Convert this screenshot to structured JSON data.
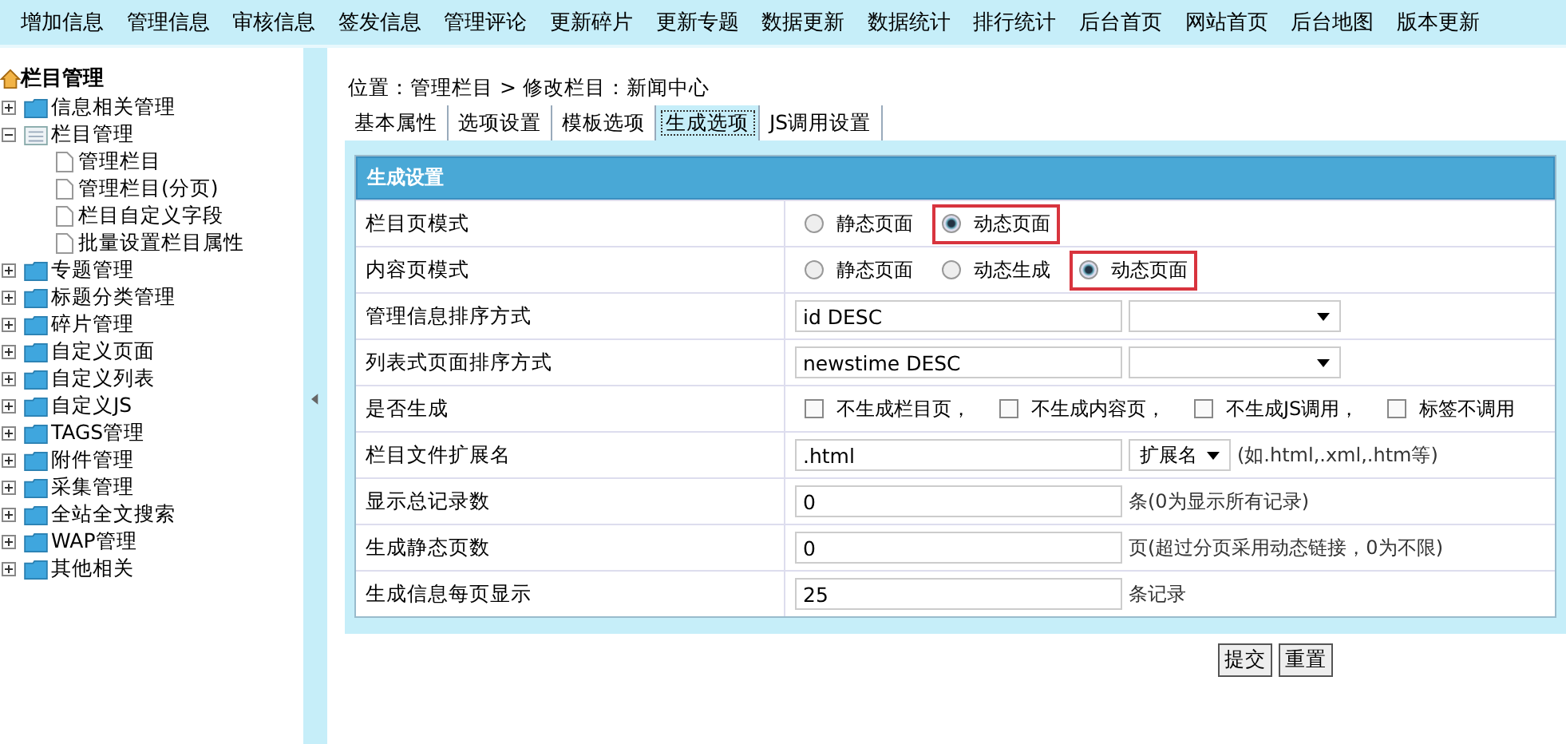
{
  "top_nav": [
    "增加信息",
    "管理信息",
    "审核信息",
    "签发信息",
    "管理评论",
    "更新碎片",
    "更新专题",
    "数据更新",
    "数据统计",
    "排行统计",
    "后台首页",
    "网站首页",
    "后台地图",
    "版本更新"
  ],
  "sidebar": {
    "title": "栏目管理",
    "items": [
      {
        "label": "信息相关管理",
        "expanded": false
      },
      {
        "label": "栏目管理",
        "expanded": true,
        "children": [
          {
            "label": "管理栏目"
          },
          {
            "label": "管理栏目(分页)"
          },
          {
            "label": "栏目自定义字段"
          },
          {
            "label": "批量设置栏目属性"
          }
        ]
      },
      {
        "label": "专题管理",
        "expanded": false
      },
      {
        "label": "标题分类管理",
        "expanded": false
      },
      {
        "label": "碎片管理",
        "expanded": false
      },
      {
        "label": "自定义页面",
        "expanded": false
      },
      {
        "label": "自定义列表",
        "expanded": false
      },
      {
        "label": "自定义JS",
        "expanded": false
      },
      {
        "label": "TAGS管理",
        "expanded": false
      },
      {
        "label": "附件管理",
        "expanded": false
      },
      {
        "label": "采集管理",
        "expanded": false
      },
      {
        "label": "全站全文搜索",
        "expanded": false
      },
      {
        "label": "WAP管理",
        "expanded": false
      },
      {
        "label": "其他相关",
        "expanded": false
      }
    ]
  },
  "breadcrumb": "位置：管理栏目 > 修改栏目：新闻中心",
  "tabs": [
    {
      "label": "基本属性",
      "selected": false
    },
    {
      "label": "选项设置",
      "selected": false
    },
    {
      "label": "模板选项",
      "selected": false
    },
    {
      "label": "生成选项",
      "selected": true
    },
    {
      "label": "JS调用设置",
      "selected": false
    }
  ],
  "form": {
    "title": "生成设置",
    "rows": [
      {
        "kind": "radio",
        "label": "栏目页模式",
        "options": [
          {
            "label": "静态页面",
            "selected": false,
            "highlighted": false
          },
          {
            "label": "动态页面",
            "selected": true,
            "highlighted": true
          }
        ]
      },
      {
        "kind": "radio",
        "label": "内容页模式",
        "options": [
          {
            "label": "静态页面",
            "selected": false,
            "highlighted": false
          },
          {
            "label": "动态生成",
            "selected": false,
            "highlighted": false
          },
          {
            "label": "动态页面",
            "selected": true,
            "highlighted": true
          }
        ]
      },
      {
        "kind": "input_select",
        "label": "管理信息排序方式",
        "value": "id DESC"
      },
      {
        "kind": "input_select",
        "label": "列表式页面排序方式",
        "value": "newstime DESC"
      },
      {
        "kind": "checkboxes",
        "label": "是否生成",
        "options": [
          {
            "label": "不生成栏目页，",
            "checked": false
          },
          {
            "label": "不生成内容页，",
            "checked": false
          },
          {
            "label": "不生成JS调用，",
            "checked": false
          },
          {
            "label": "标签不调用",
            "checked": false
          }
        ]
      },
      {
        "kind": "input_select",
        "label": "栏目文件扩展名",
        "value": ".html",
        "select": "扩展名",
        "note": "(如.html,.xml,.htm等)"
      },
      {
        "kind": "input",
        "label": "显示总记录数",
        "value": "0",
        "note": "条(0为显示所有记录)"
      },
      {
        "kind": "input",
        "label": "生成静态页数",
        "value": "0",
        "note": "页(超过分页采用动态链接，0为不限)"
      },
      {
        "kind": "input",
        "label": "生成信息每页显示",
        "value": "25",
        "note": "条记录"
      }
    ]
  },
  "buttons": [
    "提交",
    "重置"
  ]
}
